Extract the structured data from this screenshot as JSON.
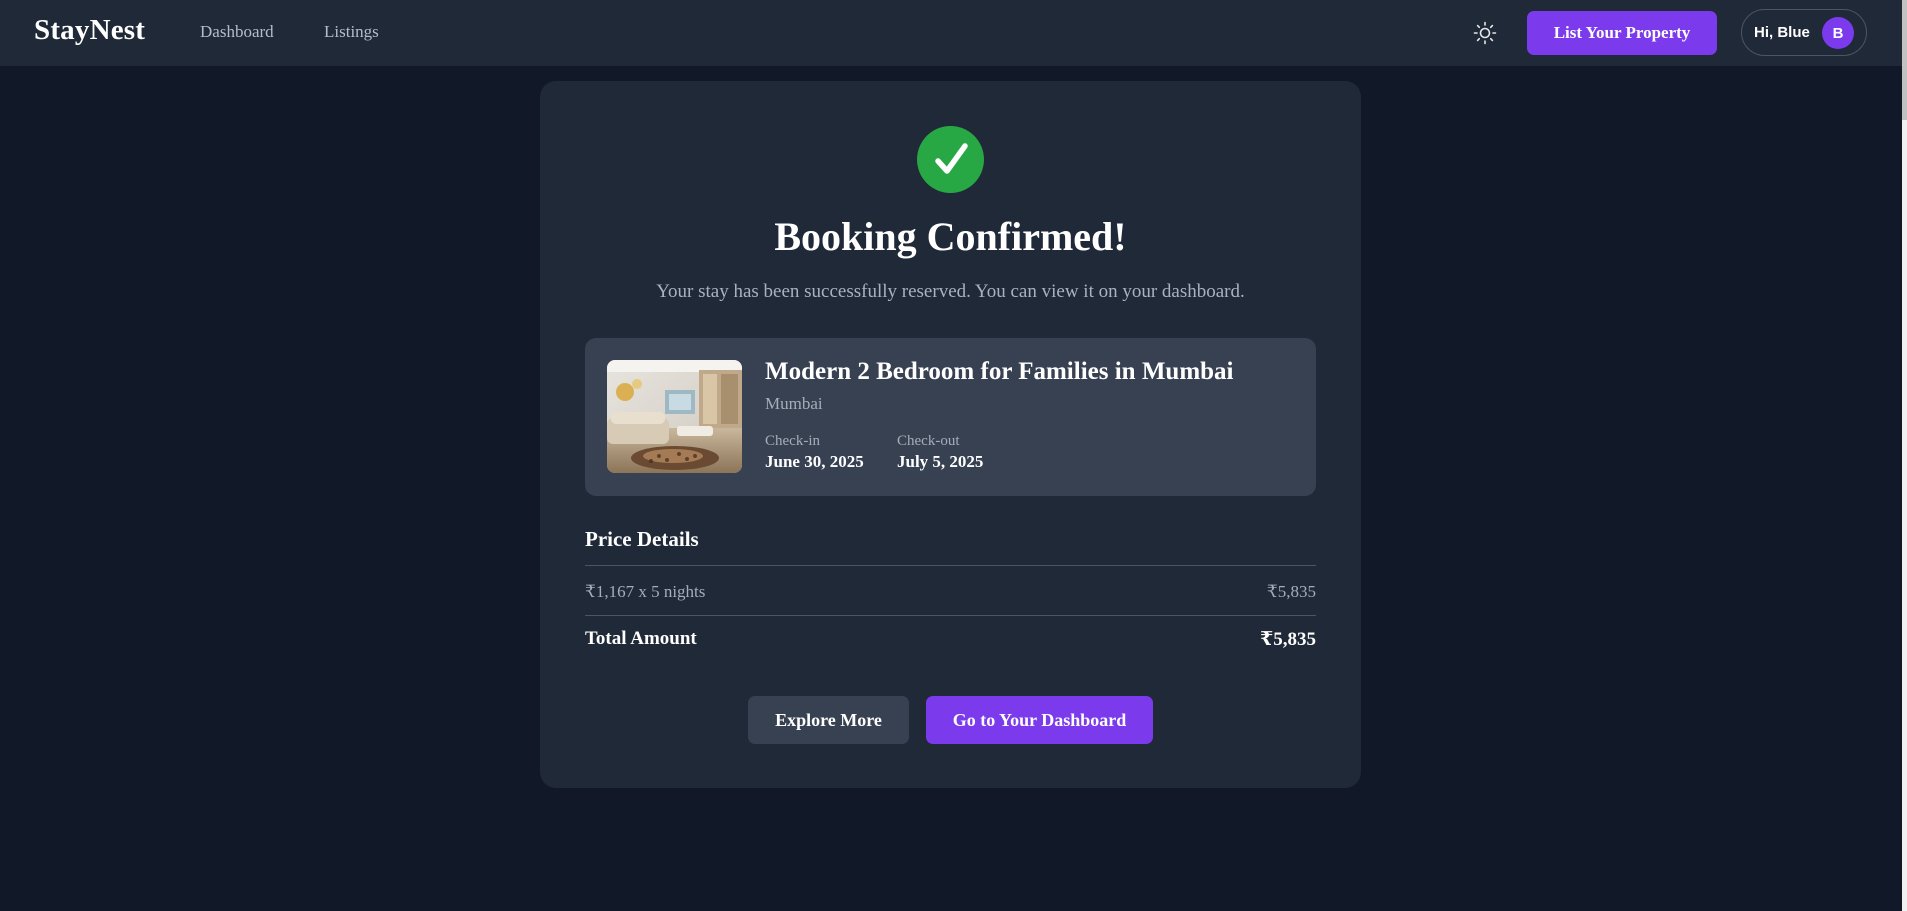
{
  "nav": {
    "brand": "StayNest",
    "links": [
      "Dashboard",
      "Listings"
    ],
    "theme_icon": "sun-icon",
    "list_property_label": "List Your Property",
    "user_greeting": "Hi, Blue",
    "avatar_initial": "B"
  },
  "confirmation": {
    "icon": "check-icon",
    "title": "Booking Confirmed!",
    "subtitle": "Your stay has been successfully reserved. You can view it on your dashboard."
  },
  "property": {
    "image_alt": "Property thumbnail of a modern living room",
    "title": "Modern 2 Bedroom for Families in Mumbai",
    "city": "Mumbai",
    "checkin_label": "Check-in",
    "checkin_date": "June 30, 2025",
    "checkout_label": "Check-out",
    "checkout_date": "July 5, 2025"
  },
  "price": {
    "heading": "Price Details",
    "line_label": "₹1,167 x 5 nights",
    "line_amount": "₹5,835",
    "total_label": "Total Amount",
    "total_amount": "₹5,835"
  },
  "actions": {
    "explore_label": "Explore More",
    "dashboard_label": "Go to Your Dashboard"
  },
  "colors": {
    "page_bg": "#111827",
    "surface": "#1f2937",
    "surface_alt": "#374151",
    "accent": "#7c3aed",
    "success": "#28a745"
  }
}
